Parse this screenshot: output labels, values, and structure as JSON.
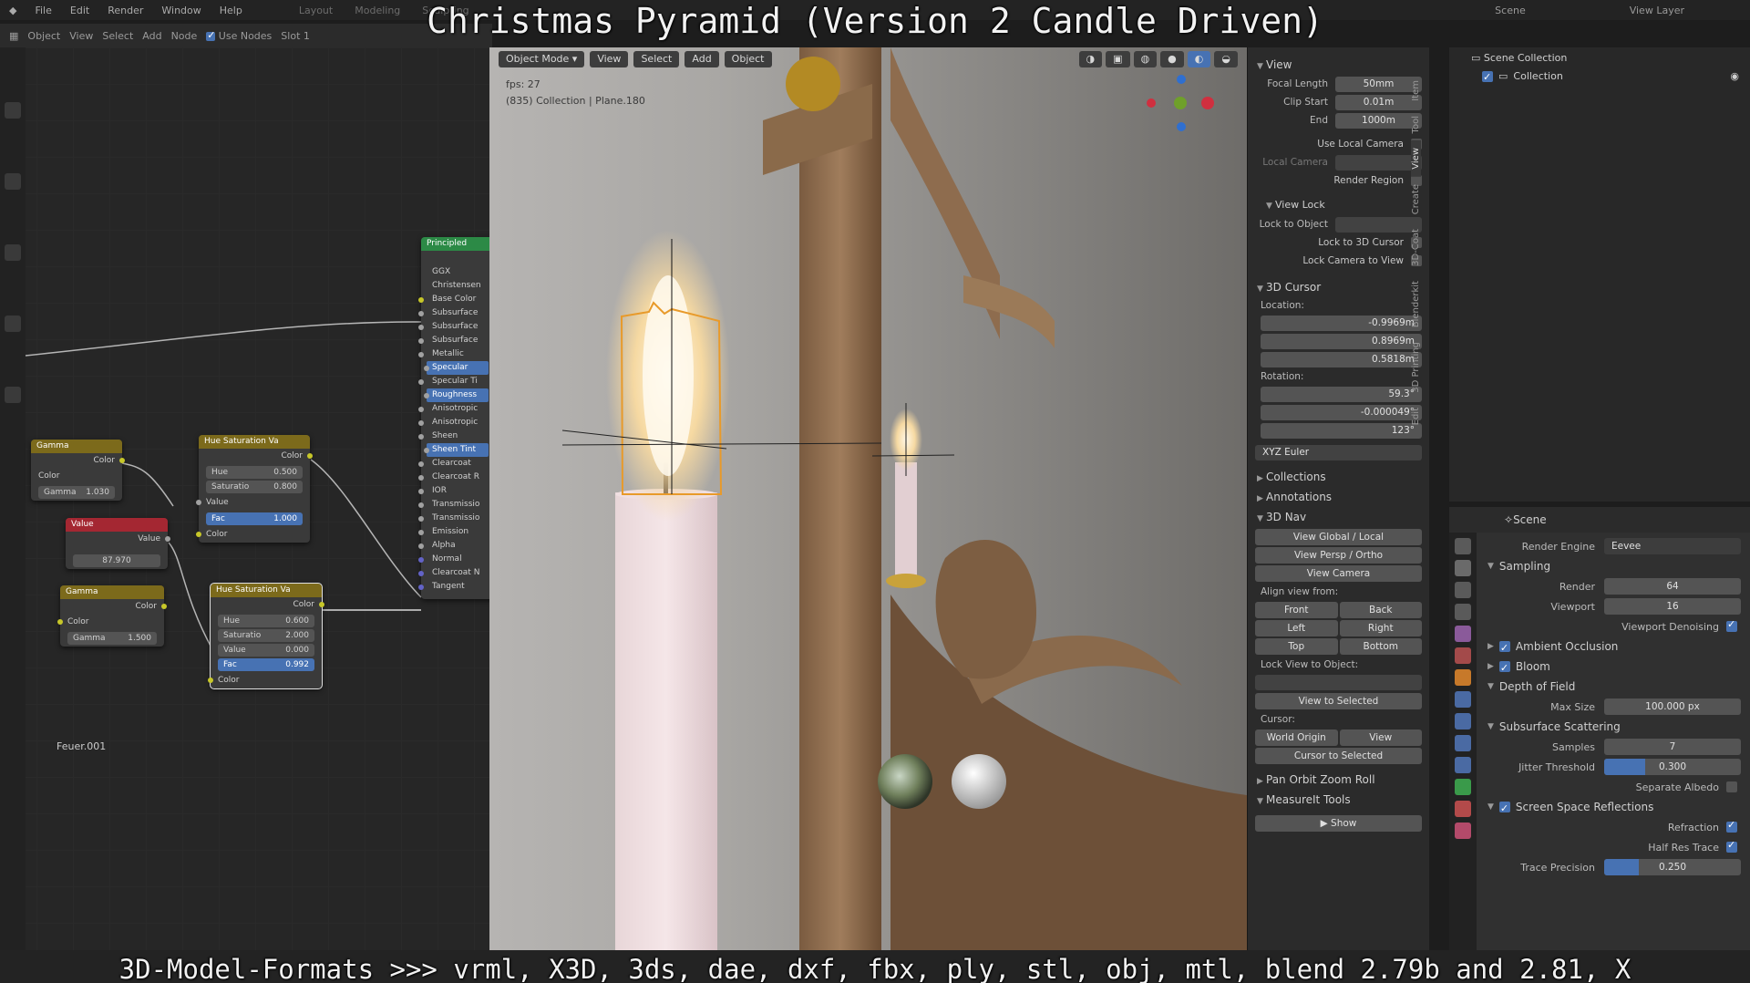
{
  "overlay": {
    "title": "Christmas Pyramid (Version 2 Candle Driven)",
    "bottom": "3D-Model-Formats >>> vrml, X3D, 3ds, dae, dxf, fbx, ply, stl, obj, mtl, blend 2.79b and 2.81, X"
  },
  "topbar": {
    "menus": [
      "File",
      "Edit",
      "Render",
      "Window",
      "Help"
    ],
    "workspaces": [
      "Layout",
      "Modeling",
      "Sculpting"
    ],
    "scene": "Scene",
    "view_layer": "View Layer"
  },
  "node_editor": {
    "header": {
      "object": "Object",
      "view": "View",
      "select": "Select",
      "add": "Add",
      "node": "Node",
      "use_nodes": "Use Nodes",
      "slot": "Slot 1"
    },
    "frame_label": "Feuer.001",
    "gamma1": {
      "title": "Gamma",
      "out": "Color",
      "in_color": "Color",
      "gamma_label": "Gamma",
      "gamma_value": "1.030"
    },
    "value": {
      "title": "Value",
      "out": "Value",
      "value": "87.970"
    },
    "gamma2": {
      "title": "Gamma",
      "out": "Color",
      "in_color": "Color",
      "gamma_label": "Gamma",
      "gamma_value": "1.500"
    },
    "hsv1": {
      "title": "Hue Saturation Va",
      "out": "Color",
      "hue_label": "Hue",
      "hue": "0.500",
      "sat_label": "Saturatio",
      "sat": "0.800",
      "value_label": "Value",
      "fac_label": "Fac",
      "fac": "1.000",
      "color_label": "Color"
    },
    "hsv2": {
      "title": "Hue Saturation Va",
      "out": "Color",
      "hue_label": "Hue",
      "hue": "0.600",
      "sat_label": "Saturatio",
      "sat": "2.000",
      "value_label": "Value",
      "value": "0.000",
      "fac_label": "Fac",
      "fac": "0.992",
      "color_label": "Color"
    },
    "principled": {
      "title": "Principled",
      "rows": [
        "GGX",
        "Christensen",
        "Base Color",
        "Subsurface",
        "Subsurface",
        "Subsurface",
        "Metallic",
        "Specular",
        "Specular Ti",
        "Roughness",
        "Anisotropic",
        "Anisotropic",
        "Sheen",
        "Sheen Tint",
        "Clearcoat",
        "Clearcoat R",
        "IOR",
        "Transmissio",
        "Transmissio",
        "Emission",
        "Alpha",
        "Normal",
        "Clearcoat N",
        "Tangent"
      ],
      "selected": [
        7,
        9,
        13
      ]
    }
  },
  "viewport": {
    "mode": "Object Mode",
    "menus": [
      "View",
      "Select",
      "Add",
      "Object"
    ],
    "fps": "fps: 27",
    "info": "(835) Collection | Plane.180"
  },
  "npanel": {
    "view_section": "View",
    "focal_label": "Focal Length",
    "focal": "50mm",
    "clip_start_label": "Clip Start",
    "clip_start": "0.01m",
    "clip_end_label": "End",
    "clip_end": "1000m",
    "use_local_camera": "Use Local Camera",
    "local_camera": "Local Camera",
    "render_region": "Render Region",
    "view_lock": "View Lock",
    "lock_to_object": "Lock to Object",
    "lock_to_cursor": "Lock to 3D Cursor",
    "lock_camera": "Lock Camera to View",
    "cursor_section": "3D Cursor",
    "location": "Location:",
    "loc_x": "-0.9969m",
    "loc_y": "0.8969m",
    "loc_z": "0.5818m",
    "rotation": "Rotation:",
    "rot_x": "59.3°",
    "rot_y": "-0.000049°",
    "rot_z": "123°",
    "rot_mode": "XYZ Euler",
    "collections": "Collections",
    "annotations": "Annotations",
    "nav": "3D Nav",
    "view_global": "View Global / Local",
    "view_persp": "View Persp / Ortho",
    "view_camera": "View Camera",
    "align_from": "Align view from:",
    "front": "Front",
    "back": "Back",
    "left": "Left",
    "right": "Right",
    "top": "Top",
    "bottom": "Bottom",
    "lock_view_obj": "Lock View to Object:",
    "view_selected": "View to Selected",
    "cursor": "Cursor:",
    "world_origin": "World Origin",
    "view": "View",
    "cursor_selected": "Cursor to Selected",
    "pan_orbit": "Pan Orbit Zoom Roll",
    "measureit": "MeasureIt Tools",
    "show": "Show",
    "tabs": [
      "Item",
      "Tool",
      "View",
      "Create",
      "3D-Coat",
      "Blenderkit",
      "3D Printing",
      "Edit"
    ]
  },
  "outliner": {
    "scene_collection": "Scene Collection",
    "collection": "Collection"
  },
  "properties": {
    "header": "Scene",
    "render_engine_label": "Render Engine",
    "render_engine": "Eevee",
    "sampling": "Sampling",
    "render_label": "Render",
    "render": "64",
    "viewport_label": "Viewport",
    "viewport": "16",
    "viewport_denoising": "Viewport Denoising",
    "ambient_occlusion": "Ambient Occlusion",
    "bloom": "Bloom",
    "depth_of_field": "Depth of Field",
    "max_size_label": "Max Size",
    "max_size": "100.000 px",
    "sss": "Subsurface Scattering",
    "samples_label": "Samples",
    "samples": "7",
    "jitter_label": "Jitter Threshold",
    "jitter": "0.300",
    "jitter_fill": 0.3,
    "separate_albedo": "Separate Albedo",
    "ssr": "Screen Space Reflections",
    "refraction": "Refraction",
    "half_res": "Half Res Trace",
    "trace_precision_label": "Trace Precision",
    "trace_precision": "0.250",
    "trace_fill": 0.25
  },
  "colors": {
    "accent": "#4772b3",
    "node_yellow": "#7c6a1b",
    "node_red": "#a42732",
    "node_green": "#2c8a46",
    "selection_orange": "#e89a2a"
  }
}
